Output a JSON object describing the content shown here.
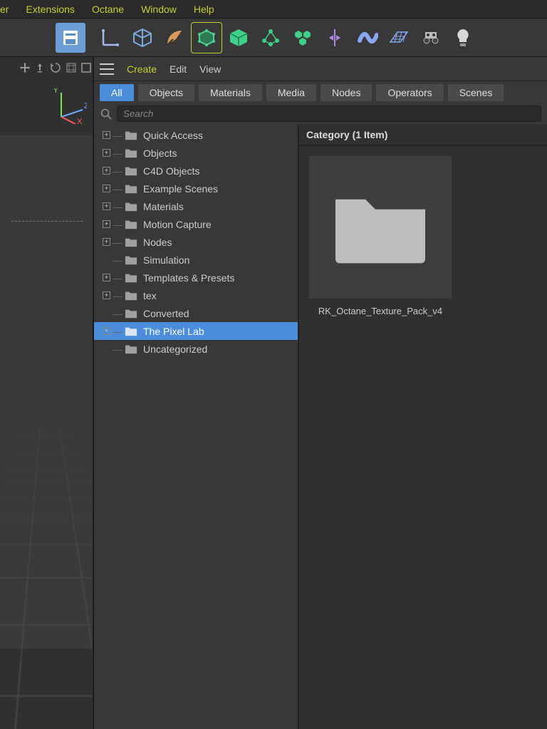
{
  "menubar": {
    "items": [
      "er",
      "Extensions",
      "Octane",
      "Window",
      "Help"
    ],
    "highlight": 3
  },
  "toolbar": {
    "icons": [
      "dropdown-icon",
      "axes-icon",
      "cube-icon",
      "pen-icon",
      "bounding-box-icon",
      "cube-solid-icon",
      "mograph-icon",
      "array-icon",
      "symmetry-icon",
      "deformer-icon",
      "plane-icon",
      "camera-icon",
      "light-icon"
    ]
  },
  "viewport": {
    "axes": {
      "x": "X",
      "y": "Y",
      "z": "Z"
    },
    "icons": [
      "move-icon",
      "zoom-icon",
      "rotate-icon",
      "ortho-icon",
      "maximize-icon"
    ]
  },
  "browser": {
    "menu": {
      "create": "Create",
      "edit": "Edit",
      "view": "View"
    },
    "filters": [
      "All",
      "Objects",
      "Materials",
      "Media",
      "Nodes",
      "Operators",
      "Scenes"
    ],
    "active_filter": 0,
    "search": {
      "placeholder": "Search"
    }
  },
  "tree": {
    "items": [
      {
        "label": "Quick Access",
        "expandable": true
      },
      {
        "label": "Objects",
        "expandable": true
      },
      {
        "label": "C4D Objects",
        "expandable": true
      },
      {
        "label": "Example Scenes",
        "expandable": true
      },
      {
        "label": "Materials",
        "expandable": true
      },
      {
        "label": "Motion Capture",
        "expandable": true
      },
      {
        "label": "Nodes",
        "expandable": true
      },
      {
        "label": "Simulation",
        "expandable": false
      },
      {
        "label": "Templates & Presets",
        "expandable": true
      },
      {
        "label": "tex",
        "expandable": true
      },
      {
        "label": "Converted",
        "expandable": false
      },
      {
        "label": "The Pixel Lab",
        "expandable": true,
        "selected": true
      },
      {
        "label": "Uncategorized",
        "expandable": false
      }
    ]
  },
  "content": {
    "header": "Category (1 Item)",
    "items": [
      {
        "label": "RK_Octane_Texture_Pack_v4"
      }
    ]
  }
}
